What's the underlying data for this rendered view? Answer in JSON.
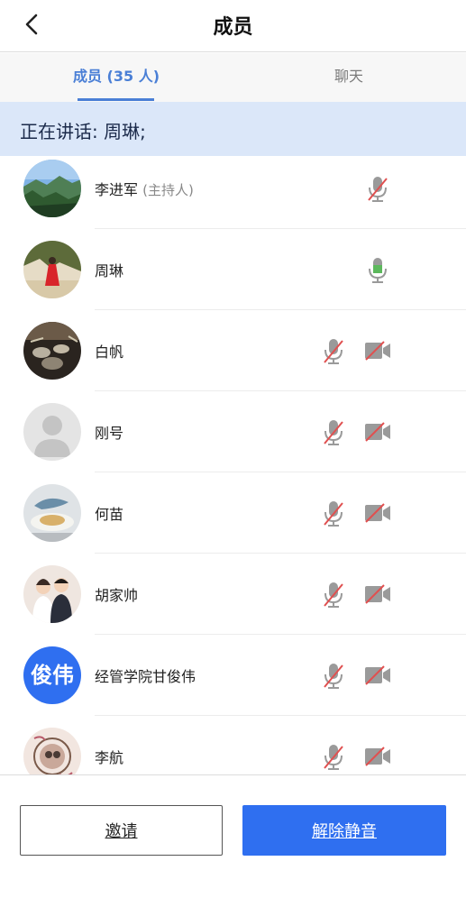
{
  "header": {
    "title": "成员"
  },
  "tabs": [
    {
      "label": "成员 (35 人)",
      "active": true
    },
    {
      "label": "聊天",
      "active": false
    }
  ],
  "speaking": {
    "text": "正在讲话: 周琳;"
  },
  "members": [
    {
      "name": "李进军",
      "role": "(主持人)",
      "avatar": "landscape",
      "mic": "muted",
      "camera": null
    },
    {
      "name": "周琳",
      "role": "",
      "avatar": "portrait-red",
      "mic": "active",
      "camera": null
    },
    {
      "name": "白帆",
      "role": "",
      "avatar": "drums",
      "mic": "muted",
      "camera": "off"
    },
    {
      "name": "刚号",
      "role": "",
      "avatar": "default",
      "mic": "muted",
      "camera": "off"
    },
    {
      "name": "何苗",
      "role": "",
      "avatar": "food",
      "mic": "muted",
      "camera": "off"
    },
    {
      "name": "胡家帅",
      "role": "",
      "avatar": "couple",
      "mic": "muted",
      "camera": "off"
    },
    {
      "name": "经管学院甘俊伟",
      "role": "",
      "avatar": "text",
      "avatar_text": "俊伟",
      "mic": "muted",
      "camera": "off"
    },
    {
      "name": "李航",
      "role": "",
      "avatar": "frame",
      "mic": "muted",
      "camera": "off"
    }
  ],
  "bottom": {
    "invite_label": "邀请",
    "unmute_label": "解除静音"
  },
  "colors": {
    "accent": "#2f6ff0",
    "tab_active": "#4a7fd6",
    "mic_active": "#5cb85c",
    "muted_slash": "#e05050"
  }
}
